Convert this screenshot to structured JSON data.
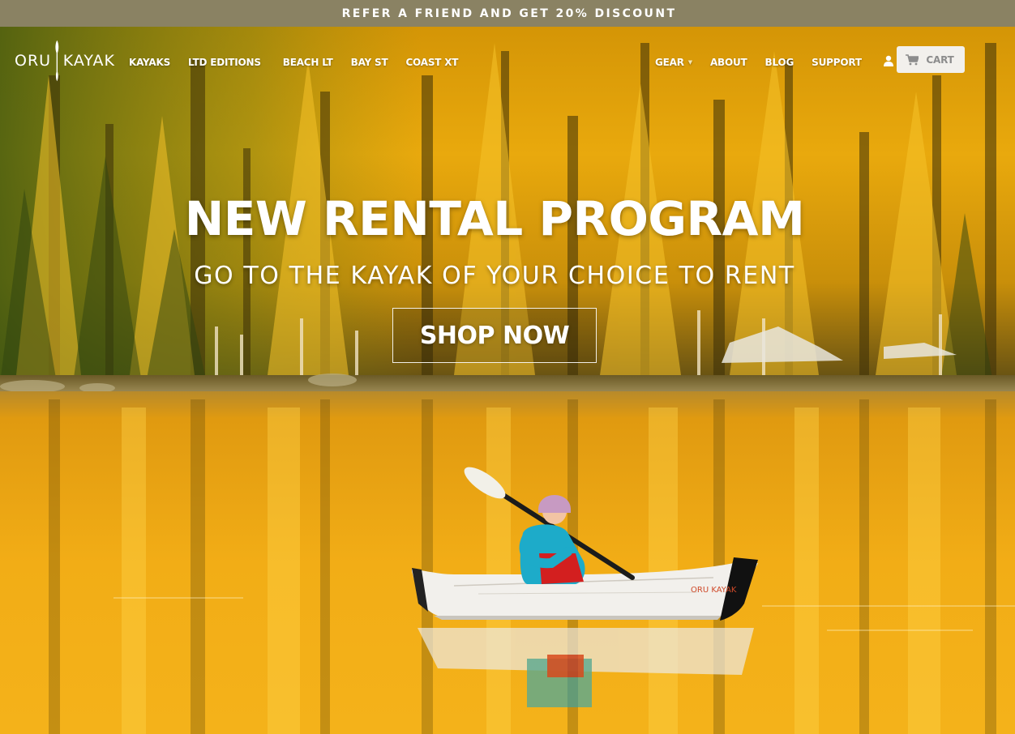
{
  "promo_banner": {
    "text": "REFER A FRIEND AND GET 20% DISCOUNT"
  },
  "logo": {
    "left_word": "ORU",
    "right_word": "KAYAK"
  },
  "nav": {
    "left_items": [
      {
        "label": "KAYAKS"
      },
      {
        "label": "LTD EDITIONS"
      },
      {
        "label": "BEACH LT"
      },
      {
        "label": "BAY ST"
      },
      {
        "label": "COAST XT"
      }
    ],
    "right_items": [
      {
        "label": "GEAR",
        "has_dropdown": true
      },
      {
        "label": "ABOUT"
      },
      {
        "label": "BLOG"
      },
      {
        "label": "SUPPORT"
      }
    ],
    "account_icon": "user-icon",
    "cart": {
      "label": "CART",
      "icon": "cart-icon"
    }
  },
  "hero": {
    "title": "NEW RENTAL PROGRAM",
    "subtitle": "GO TO THE KAYAK OF YOUR CHOICE TO RENT",
    "cta_label": "SHOP NOW",
    "kayak_brand": "ORU KAYAK"
  },
  "colors": {
    "promo_bg": "#8a8263",
    "forest_gold": "#e8a40f",
    "water_gold": "#f0a915",
    "cart_bg": "#f2f0ec",
    "text_white": "#ffffff"
  }
}
